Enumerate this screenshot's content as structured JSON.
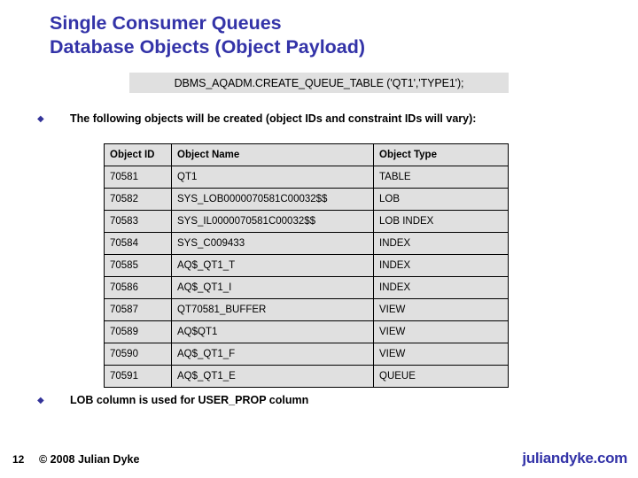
{
  "slide": {
    "title_lines": [
      "Single Consumer Queues",
      "Database Objects (Object Payload)"
    ],
    "title_color": "#3333a8",
    "code_snippet": "DBMS_AQADM.CREATE_QUEUE_TABLE ('QT1','TYPE1');",
    "bullets": [
      {
        "marker": "◆",
        "text": "The following objects will be created (object IDs and constraint IDs will vary):"
      },
      {
        "marker": "◆",
        "text": "LOB column is used for USER_PROP column"
      }
    ],
    "table": {
      "headers": [
        "Object ID",
        "Object Name",
        "Object Type"
      ],
      "rows": [
        [
          "70581",
          "QT1",
          "TABLE"
        ],
        [
          "70582",
          "SYS_LOB0000070581C00032$$",
          "LOB"
        ],
        [
          "70583",
          "SYS_IL0000070581C00032$$",
          "LOB INDEX"
        ],
        [
          "70584",
          "SYS_C009433",
          "INDEX"
        ],
        [
          "70585",
          "AQ$_QT1_T",
          "INDEX"
        ],
        [
          "70586",
          "AQ$_QT1_I",
          "INDEX"
        ],
        [
          "70587",
          "QT70581_BUFFER",
          "VIEW"
        ],
        [
          "70589",
          "AQ$QT1",
          "VIEW"
        ],
        [
          "70590",
          "AQ$_QT1_F",
          "VIEW"
        ],
        [
          "70591",
          "AQ$_QT1_E",
          "QUEUE"
        ]
      ]
    },
    "footer": {
      "page_number": "12",
      "copyright": "© 2008 Julian Dyke",
      "brand": "juliandyke.com",
      "brand_color": "#3333a8"
    }
  }
}
